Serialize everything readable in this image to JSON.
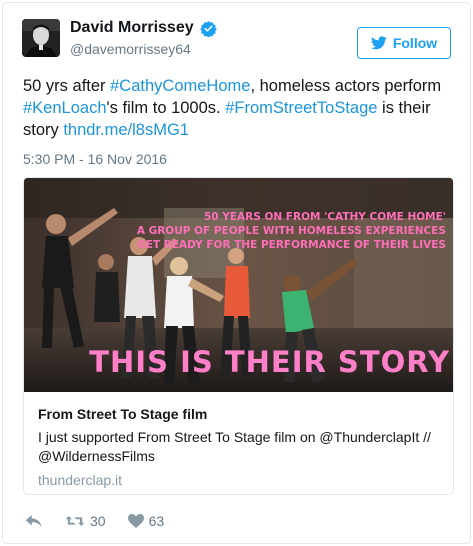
{
  "author": {
    "name": "David Morrissey",
    "handle": "@davemorrissey64"
  },
  "follow_label": "Follow",
  "tweet": {
    "parts": [
      {
        "t": "50 yrs after ",
        "link": false
      },
      {
        "t": "#CathyComeHome",
        "link": true
      },
      {
        "t": ", homeless actors perform ",
        "link": false
      },
      {
        "t": "#KenLoach",
        "link": true
      },
      {
        "t": "'s film to 1000s. ",
        "link": false
      },
      {
        "t": "#FromStreetToStage",
        "link": true
      },
      {
        "t": " is their story ",
        "link": false
      },
      {
        "t": "thndr.me/l8sMG1",
        "link": true
      }
    ],
    "timestamp": "5:30 PM - 16 Nov 2016"
  },
  "card": {
    "overlay_lines": [
      "50 YEARS ON FROM 'CATHY COME HOME'",
      "A GROUP OF PEOPLE WITH HOMELESS EXPERIENCES",
      "GET READY FOR THE PERFORMANCE OF THEIR LIVES"
    ],
    "headline": "THIS IS THEIR STORY",
    "title": "From Street To Stage film",
    "description": "I just supported From Street To Stage film on @ThunderclapIt // @WildernessFilms",
    "domain": "thunderclap.it"
  },
  "actions": {
    "retweets": "30",
    "likes": "63"
  },
  "colors": {
    "link": "#1b95e0",
    "accent": "#1da1f2",
    "headline_pink": "#ff7fc8",
    "overlay_pink": "#ff6fb8"
  }
}
